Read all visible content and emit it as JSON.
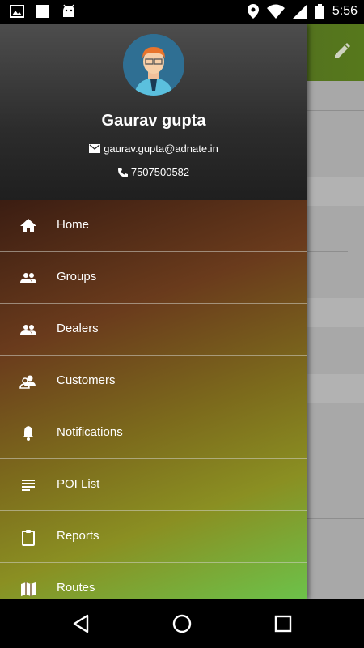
{
  "status_bar": {
    "time": "5:56",
    "left_icons": [
      "image-icon",
      "square-icon",
      "android-icon"
    ],
    "right_icons": [
      "location-icon",
      "wifi-icon",
      "signal-icon",
      "battery-icon"
    ]
  },
  "drawer": {
    "user": {
      "name": "Gaurav gupta",
      "email": "gaurav.gupta@adnate.in",
      "phone": "7507500582"
    },
    "items": [
      {
        "label": "Home",
        "icon": "home-icon"
      },
      {
        "label": "Groups",
        "icon": "groups-icon"
      },
      {
        "label": "Dealers",
        "icon": "dealers-icon"
      },
      {
        "label": "Customers",
        "icon": "customers-icon"
      },
      {
        "label": "Notifications",
        "icon": "bell-icon"
      },
      {
        "label": "POI List",
        "icon": "list-icon"
      },
      {
        "label": "Reports",
        "icon": "clipboard-icon"
      },
      {
        "label": "Routes",
        "icon": "map-icon"
      }
    ]
  },
  "background_app": {
    "toolbar_icon": "edit-icon"
  },
  "nav_bar": {
    "buttons": [
      "back-icon",
      "home-circle-icon",
      "recents-icon"
    ]
  }
}
